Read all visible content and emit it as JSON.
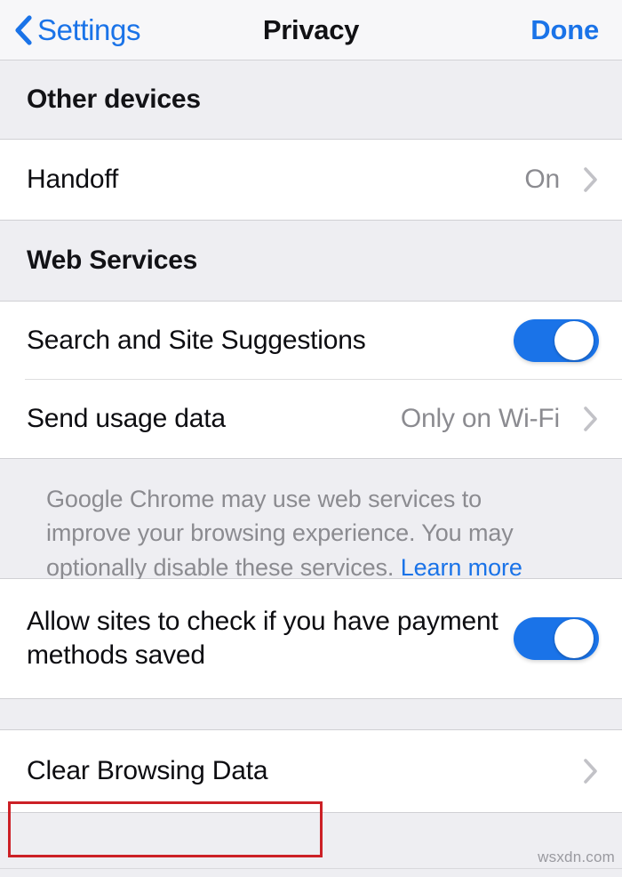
{
  "navbar": {
    "back_label": "Settings",
    "back_icon": "chevron-left-icon",
    "title": "Privacy",
    "done_label": "Done"
  },
  "sections": [
    {
      "header": "Other devices",
      "rows": [
        {
          "label": "Handoff",
          "value": "On",
          "accessory": "chevron-right-icon"
        }
      ]
    },
    {
      "header": "Web Services",
      "rows": [
        {
          "label": "Search and Site Suggestions",
          "accessory": "toggle",
          "toggle_state": "on"
        },
        {
          "label": "Send usage data",
          "value": "Only on Wi-Fi",
          "accessory": "chevron-right-icon"
        }
      ],
      "footer": {
        "text": "Google Chrome may use web services to improve your browsing experience. You may optionally disable these services. ",
        "link_label": "Learn more"
      }
    },
    {
      "header": "",
      "rows": [
        {
          "label": "Allow sites to check if you have payment methods saved",
          "accessory": "toggle",
          "toggle_state": "on"
        }
      ]
    },
    {
      "header": "",
      "rows": [
        {
          "label": "Clear Browsing Data",
          "accessory": "chevron-right-icon",
          "highlighted": "true"
        }
      ]
    }
  ],
  "colors": {
    "accent_blue": "#1a73e8",
    "annotation_red": "#cc2026",
    "value_gray": "#8b8b90",
    "page_background": "#eeeef2",
    "row_background": "#ffffff"
  },
  "watermark": "wsxdn.com"
}
